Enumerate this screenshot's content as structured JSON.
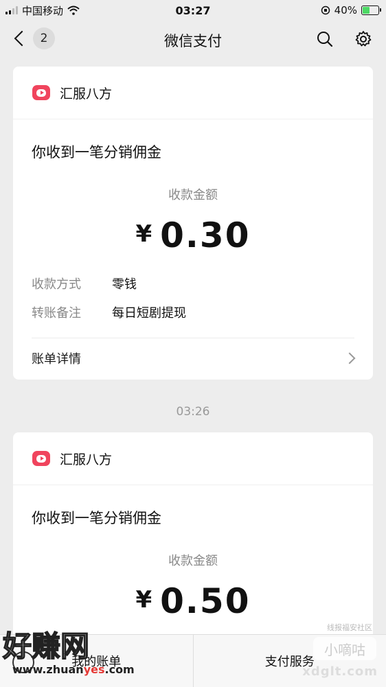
{
  "status_bar": {
    "carrier": "中国移动",
    "time": "03:27",
    "battery": "40%"
  },
  "nav": {
    "badge_count": "2",
    "title": "微信支付"
  },
  "messages": [
    {
      "app_name": "汇服八方",
      "title": "你收到一笔分销佣金",
      "amount_label": "收款金额",
      "currency": "¥",
      "amount": "0.30",
      "details": [
        {
          "key": "收款方式",
          "value": "零钱"
        },
        {
          "key": "转账备注",
          "value": "每日短剧提现"
        }
      ],
      "bill_link": "账单详情"
    },
    {
      "time": "03:26",
      "app_name": "汇服八方",
      "title": "你收到一笔分销佣金",
      "amount_label": "收款金额",
      "currency": "¥",
      "amount": "0.50"
    }
  ],
  "bottom_bar": {
    "left_label": "我的账单",
    "right_label": "支付服务"
  },
  "watermarks": {
    "logo": "好赚网",
    "url_prefix": "www.zhuan",
    "url_highlight": "yes",
    "url_suffix": ".com",
    "right_top": "线报福安社区",
    "right_box": "小嘀咕",
    "right_url": "xdglt.com"
  },
  "colors": {
    "brand_icon": "#f0445d",
    "battery_fill": "#4cd964"
  }
}
